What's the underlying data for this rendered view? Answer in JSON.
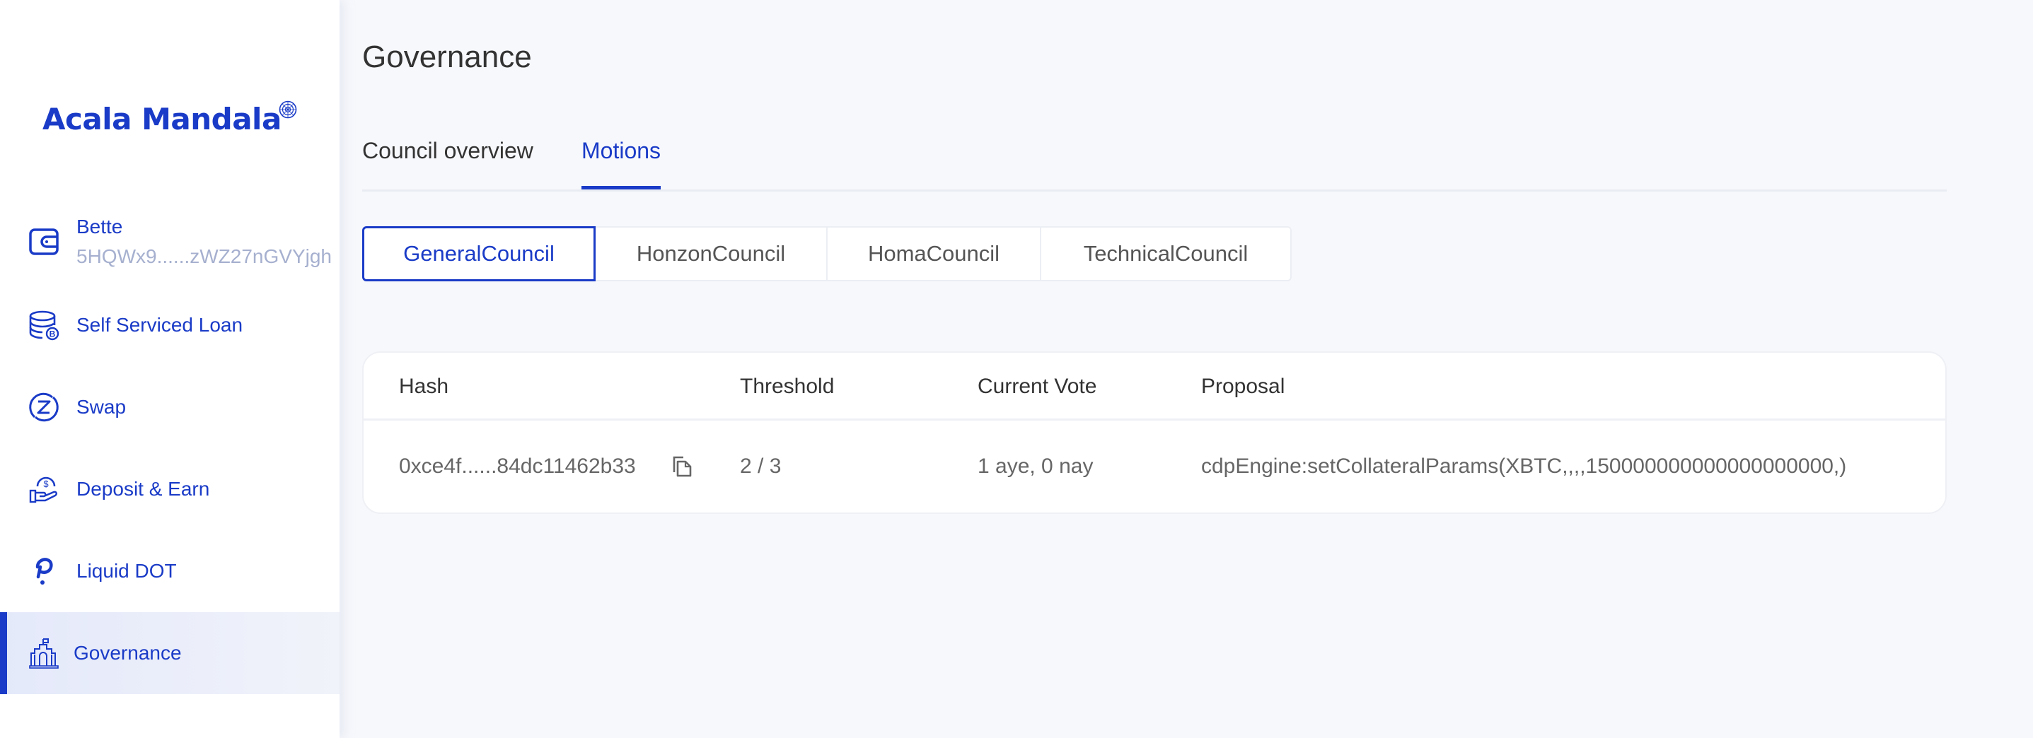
{
  "app": {
    "brand": "Acala Mandala",
    "accent_color": "#1A3BC7"
  },
  "sidebar": {
    "account": {
      "name": "Bette",
      "address": "5HQWx9......zWZ27nGVYjgh",
      "icon": "wallet-icon"
    },
    "items": [
      {
        "label": "Self Serviced Loan",
        "icon": "loan-database-icon",
        "active": false
      },
      {
        "label": "Swap",
        "icon": "swap-icon",
        "active": false
      },
      {
        "label": "Deposit & Earn",
        "icon": "deposit-hand-icon",
        "active": false
      },
      {
        "label": "Liquid DOT",
        "icon": "polkadot-icon",
        "active": false
      },
      {
        "label": "Governance",
        "icon": "governance-building-icon",
        "active": true
      }
    ]
  },
  "main": {
    "title": "Governance",
    "tabs": [
      {
        "label": "Council overview",
        "active": false
      },
      {
        "label": "Motions",
        "active": true
      }
    ],
    "councils": [
      {
        "label": "GeneralCouncil",
        "active": true
      },
      {
        "label": "HonzonCouncil",
        "active": false
      },
      {
        "label": "HomaCouncil",
        "active": false
      },
      {
        "label": "TechnicalCouncil",
        "active": false
      }
    ],
    "table": {
      "columns": [
        "Hash",
        "Threshold",
        "Current Vote",
        "Proposal"
      ],
      "rows": [
        {
          "hash": "0xce4f......84dc11462b33",
          "threshold": "2 / 3",
          "current_vote": "1 aye, 0 nay",
          "proposal": "cdpEngine:setCollateralParams(XBTC,,,,150000000000000000000,)"
        }
      ]
    }
  }
}
